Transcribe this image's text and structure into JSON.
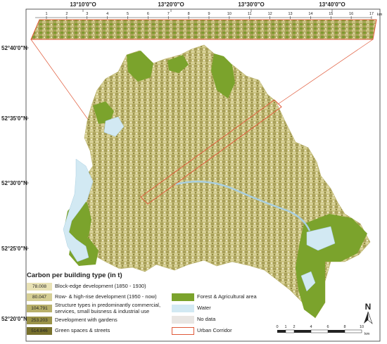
{
  "coords": {
    "top": [
      "13°10'0\"O",
      "13°20'0\"O",
      "13°30'0\"O",
      "13°40'0\"O"
    ],
    "left": [
      "52°40'0\"N",
      "52°35'0\"N",
      "52°30'0\"N",
      "52°25'0\"N",
      "52°20'0\"N"
    ]
  },
  "strip_ruler": {
    "ticks": [
      "1",
      "2",
      "3",
      "4",
      "5",
      "6",
      "7",
      "8",
      "9",
      "10",
      "11",
      "12",
      "13",
      "14",
      "15",
      "16",
      "17"
    ],
    "unit": "km"
  },
  "legend": {
    "title": "Carbon per building type (in t)",
    "building_types": [
      {
        "value": "78.008",
        "label": "Block-edge development (1850 - 1930)",
        "color": "#e9e2b5"
      },
      {
        "value": "80.047",
        "label": "Row- & high-rise development (1950 - now)",
        "color": "#d6cf95"
      },
      {
        "value": "104.791",
        "label": "Structure types in predominantly commercial, services, small buisness & industrial use",
        "color": "#b8b06a"
      },
      {
        "value": "253.203",
        "label": "Development with gardens",
        "color": "#9a9248"
      },
      {
        "value": "514.846",
        "label": "Green spaces & streets",
        "color": "#77702c"
      }
    ],
    "other": [
      {
        "label": "Forest & Agricultural area",
        "color": "#7ba32c"
      },
      {
        "label": "Water",
        "color": "#d2e9f3"
      },
      {
        "label": "No data",
        "color": "#e9e6e3"
      },
      {
        "label": "Urban Corridor",
        "color": "#e05a3a"
      }
    ]
  },
  "north_arrow": {
    "label": "N"
  },
  "scale_bar": {
    "ticks": [
      "0",
      "1",
      "2",
      "4",
      "6",
      "8",
      "10"
    ],
    "unit": "km"
  }
}
